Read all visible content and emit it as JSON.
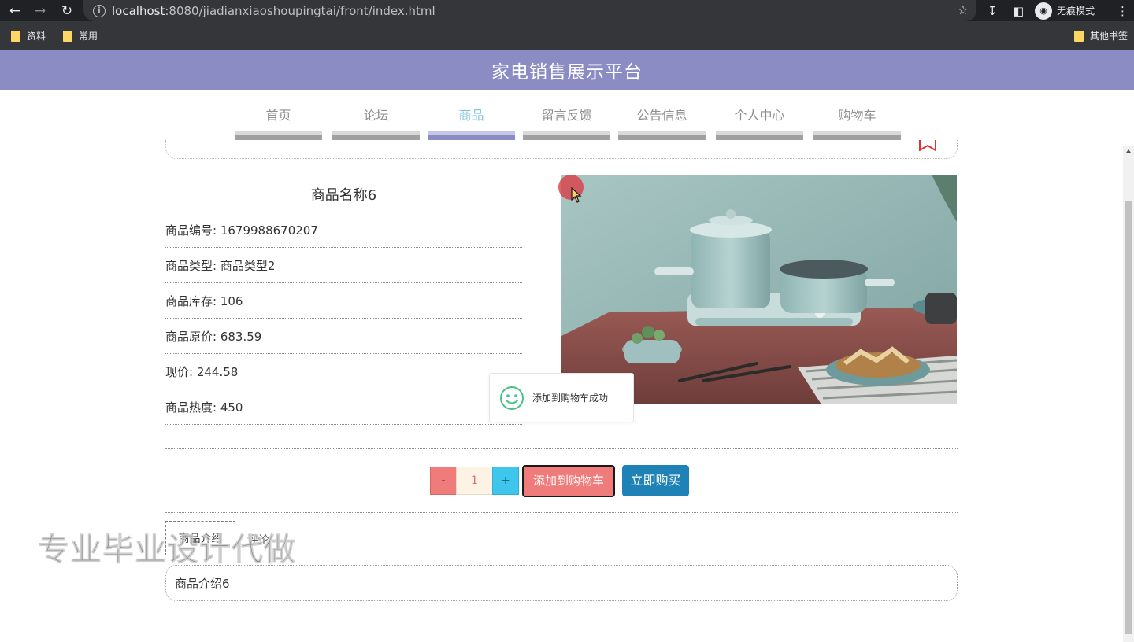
{
  "browser": {
    "url_host": "localhost",
    "url_rest": ":8080/jiadianxiaoshoupingtai/front/index.html",
    "incognito_label": "无痕模式",
    "bookmarks": [
      "资料",
      "常用"
    ],
    "other_bookmarks": "其他书签"
  },
  "site": {
    "title": "家电销售展示平台"
  },
  "nav": {
    "items": [
      {
        "label": "首页"
      },
      {
        "label": "论坛"
      },
      {
        "label": "商品"
      },
      {
        "label": "留言反馈"
      },
      {
        "label": "公告信息"
      },
      {
        "label": "个人中心"
      },
      {
        "label": "购物车"
      }
    ],
    "active": "商品"
  },
  "product": {
    "name": "商品名称6",
    "fields": [
      {
        "label": "商品编号: ",
        "value": "1679988670207"
      },
      {
        "label": "商品类型: ",
        "value": "商品类型2"
      },
      {
        "label": "商品库存: ",
        "value": "106"
      },
      {
        "label": "商品原价: ",
        "value": "683.59"
      },
      {
        "label": "现价: ",
        "value": "244.58"
      },
      {
        "label": "商品热度: ",
        "value": "450"
      }
    ],
    "image_icon": "kitchen-appliance-photo"
  },
  "toast": {
    "message": "添加到购物车成功",
    "icon": "smile-icon"
  },
  "actions": {
    "minus": "-",
    "quantity": "1",
    "plus": "+",
    "add_to_cart": "添加到购物车",
    "buy_now": "立即购买"
  },
  "detail_tabs": {
    "intro_tab": "商品介绍",
    "other_tab": "评论"
  },
  "intro": {
    "text": "商品介绍6"
  },
  "watermark": "专业毕业设计代做",
  "colors": {
    "header": "#8c8cc4",
    "nav_active": "#7fc7e0",
    "cart_button": "#f07b7b",
    "buy_button": "#1f82b7",
    "plus_button": "#3fc6ec"
  }
}
